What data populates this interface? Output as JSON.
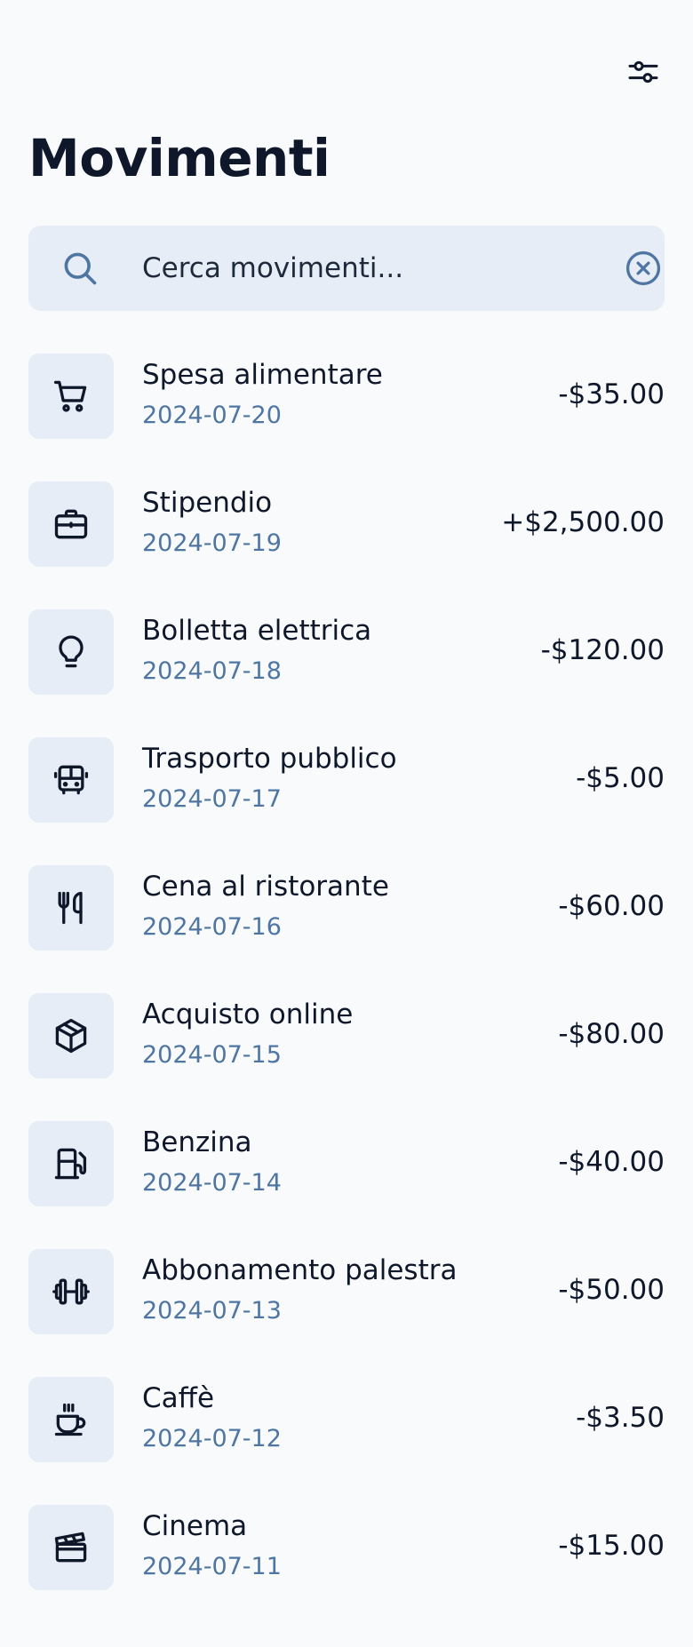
{
  "header": {
    "title": "Movimenti",
    "filter_icon": "sliders-icon"
  },
  "search": {
    "placeholder": "Cerca movimenti...",
    "value": "",
    "search_icon": "search-icon",
    "clear_icon": "clear-circle-icon"
  },
  "transactions": [
    {
      "name": "Spesa alimentare",
      "date": "2024-07-20",
      "amount": "-$35.00",
      "icon": "cart-icon"
    },
    {
      "name": "Stipendio",
      "date": "2024-07-19",
      "amount": "+$2,500.00",
      "icon": "briefcase-icon"
    },
    {
      "name": "Bolletta elettrica",
      "date": "2024-07-18",
      "amount": "-$120.00",
      "icon": "lightbulb-icon"
    },
    {
      "name": "Trasporto pubblico",
      "date": "2024-07-17",
      "amount": "-$5.00",
      "icon": "bus-icon"
    },
    {
      "name": "Cena al ristorante",
      "date": "2024-07-16",
      "amount": "-$60.00",
      "icon": "utensils-icon"
    },
    {
      "name": "Acquisto online",
      "date": "2024-07-15",
      "amount": "-$80.00",
      "icon": "package-icon"
    },
    {
      "name": "Benzina",
      "date": "2024-07-14",
      "amount": "-$40.00",
      "icon": "fuel-icon"
    },
    {
      "name": "Abbonamento palestra",
      "date": "2024-07-13",
      "amount": "-$50.00",
      "icon": "dumbbell-icon"
    },
    {
      "name": "Caffè",
      "date": "2024-07-12",
      "amount": "-$3.50",
      "icon": "coffee-icon"
    },
    {
      "name": "Cinema",
      "date": "2024-07-11",
      "amount": "-$15.00",
      "icon": "clapperboard-icon"
    }
  ],
  "colors": {
    "background": "#f8fafc",
    "icon_tile": "#e6edf6",
    "date_text": "#4f76a3",
    "accent_icon": "#4f76a3",
    "text": "#0f172a"
  }
}
